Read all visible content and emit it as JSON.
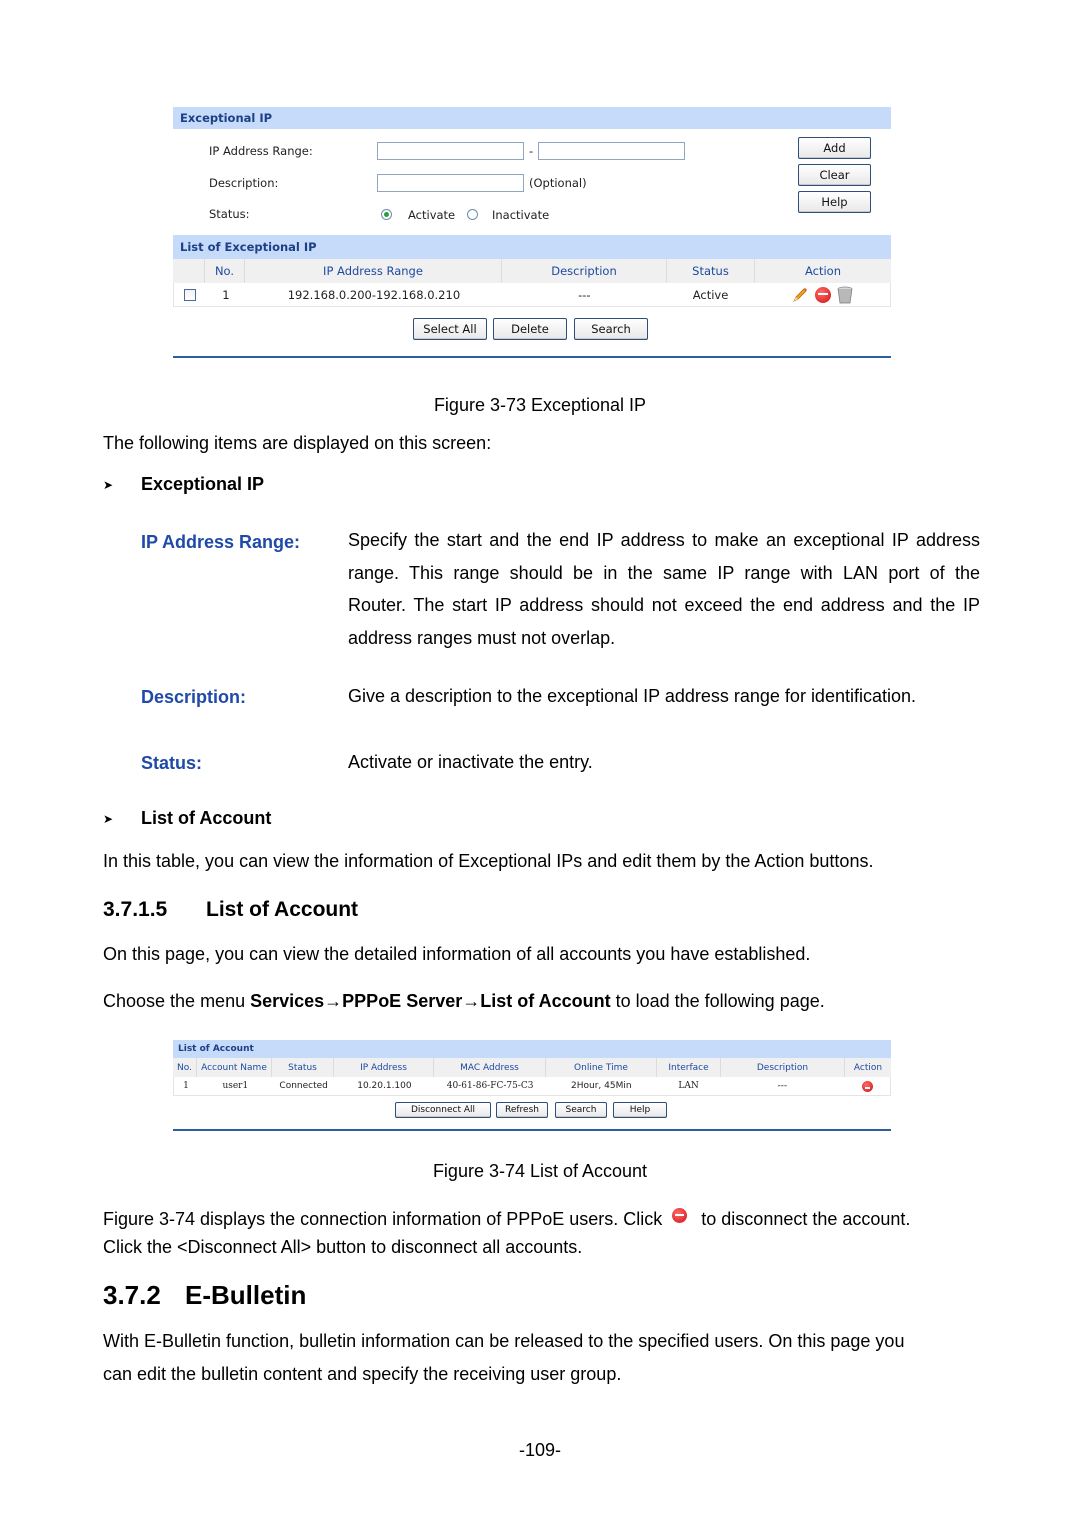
{
  "figure_73": {
    "panel_title": "Exceptional IP",
    "form": {
      "ip_range_label": "IP Address Range:",
      "ip_range_start_value": "",
      "ip_range_separator": "-",
      "ip_range_end_value": "",
      "description_label": "Description:",
      "description_value": "",
      "description_hint": "(Optional)",
      "status_label": "Status:",
      "status_options": [
        "Activate",
        "Inactivate"
      ],
      "status_selected": "Activate"
    },
    "side_buttons": {
      "add": "Add",
      "clear": "Clear",
      "help": "Help"
    },
    "list_title": "List of Exceptional IP",
    "columns": [
      "",
      "No.",
      "IP Address Range",
      "Description",
      "Status",
      "Action"
    ],
    "rows": [
      {
        "checked": false,
        "no": "1",
        "ip_range": "192.168.0.200-192.168.0.210",
        "description": "---",
        "status": "Active",
        "actions": [
          "edit-icon",
          "disable-icon",
          "delete-icon"
        ]
      }
    ],
    "bottom_buttons": {
      "select_all": "Select All",
      "delete": "Delete",
      "search": "Search"
    },
    "caption": "Figure 3-73 Exceptional IP"
  },
  "text": {
    "intro": "The following items are displayed on this screen:",
    "bullet_1": "Exceptional IP",
    "definitions": [
      {
        "term": "IP Address Range:",
        "lines": [
          "Specify the start and the end IP address to make an exceptional IP address",
          "range. This range should be in the same IP range with LAN port of the",
          "Router. The start IP address should not exceed the end address and the IP",
          "address ranges must not overlap."
        ]
      },
      {
        "term": "Description:",
        "lines": [
          "Give a description to the exceptional IP address range for identification."
        ]
      },
      {
        "term": "Status:",
        "lines": [
          "Activate or inactivate the entry."
        ]
      }
    ],
    "bullet_2": "List of Account",
    "bullet_2_desc": "In this table, you can view the information of Exceptional IPs and edit them by the Action buttons.",
    "section_3715_number": "3.7.1.5",
    "section_3715_title": "List of Account",
    "section_3715_p1": "On this page, you can view the detailed information of all accounts you have established.",
    "menu_path": {
      "prefix": "Choose the menu ",
      "item_1": "Services",
      "arrow": "→",
      "item_2": "PPPoE Server",
      "item_3": "List of Account",
      "suffix": " to load the following page."
    },
    "fig74_desc_pre": "Figure 3-74 displays the connection information of PPPoE users. Click",
    "fig74_desc_post": "to disconnect the account.",
    "fig74_desc_line2": "Click the <Disconnect All> button to disconnect all accounts.",
    "section_372_number": "3.7.2",
    "section_372_title": "E-Bulletin",
    "section_372_line1": "With E-Bulletin function, bulletin information can be released to the specified users. On this page you",
    "section_372_line2": "can edit the bulletin content and specify the receiving user group.",
    "page_number": "-109-"
  },
  "figure_74": {
    "panel_title": "List of Account",
    "columns": [
      "No.",
      "Account Name",
      "Status",
      "IP Address",
      "MAC Address",
      "Online Time",
      "Interface",
      "Description",
      "Action"
    ],
    "rows": [
      {
        "no": "1",
        "account_name": "user1",
        "status": "Connected",
        "ip": "10.20.1.100",
        "mac": "40-61-86-FC-75-C3",
        "online_time": "2Hour, 45Min",
        "interface": "LAN",
        "description": "---",
        "action": "disconnect-icon"
      }
    ],
    "buttons": {
      "disconnect_all": "Disconnect All",
      "refresh": "Refresh",
      "search": "Search",
      "help": "Help"
    },
    "caption": "Figure 3-74 List of Account"
  },
  "colors": {
    "panel_header_bg": "#c6dbfa",
    "panel_header_text": "#1d3f85",
    "column_header_text": "#1d4aa0",
    "term_blue": "#1f4aa8",
    "rule_blue": "#2b5f9e"
  }
}
